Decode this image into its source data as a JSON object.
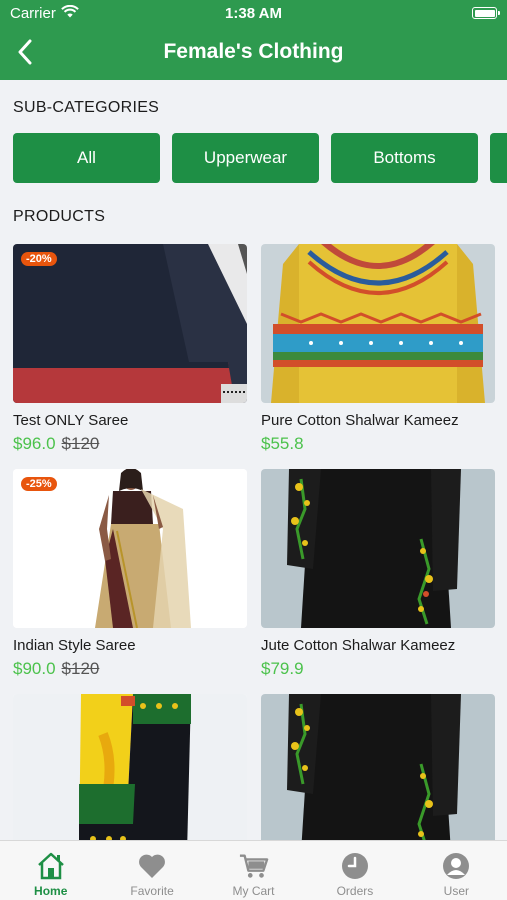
{
  "status_bar": {
    "carrier": "Carrier",
    "time": "1:38 AM"
  },
  "nav": {
    "title": "Female's Clothing"
  },
  "sections": {
    "subcategories": "SUB-CATEGORIES",
    "products": "PRODUCTS"
  },
  "subcategories": [
    {
      "label": "All"
    },
    {
      "label": "Upperwear"
    },
    {
      "label": "Bottoms"
    },
    {
      "label": ""
    }
  ],
  "products": [
    {
      "name": "Test ONLY Saree",
      "price": "$96.0",
      "old_price": "$120",
      "discount": "-20%",
      "image": "black-red-saree"
    },
    {
      "name": "Pure Cotton Shalwar Kameez",
      "price": "$55.8",
      "old_price": "",
      "discount": "",
      "image": "yellow-kameez"
    },
    {
      "name": "Indian Style Saree",
      "price": "$90.0",
      "old_price": "$120",
      "discount": "-25%",
      "image": "beige-saree-model"
    },
    {
      "name": "Jute Cotton Shalwar Kameez",
      "price": "$79.9",
      "old_price": "",
      "discount": "",
      "image": "black-embroidered-kameez"
    },
    {
      "name": "",
      "price": "",
      "old_price": "",
      "discount": "",
      "image": "yellow-green-dupatta"
    },
    {
      "name": "",
      "price": "",
      "old_price": "",
      "discount": "",
      "image": "black-embroidered-kameez"
    }
  ],
  "tabs": [
    {
      "label": "Home",
      "icon": "home-icon",
      "active": true
    },
    {
      "label": "Favorite",
      "icon": "heart-icon",
      "active": false
    },
    {
      "label": "My Cart",
      "icon": "cart-icon",
      "active": false
    },
    {
      "label": "Orders",
      "icon": "clock-icon",
      "active": false
    },
    {
      "label": "User",
      "icon": "user-icon",
      "active": false
    }
  ],
  "colors": {
    "primary": "#2e9a4f",
    "chip": "#1e8f45",
    "price": "#4cc24c",
    "discount_badge": "#e8550d"
  }
}
